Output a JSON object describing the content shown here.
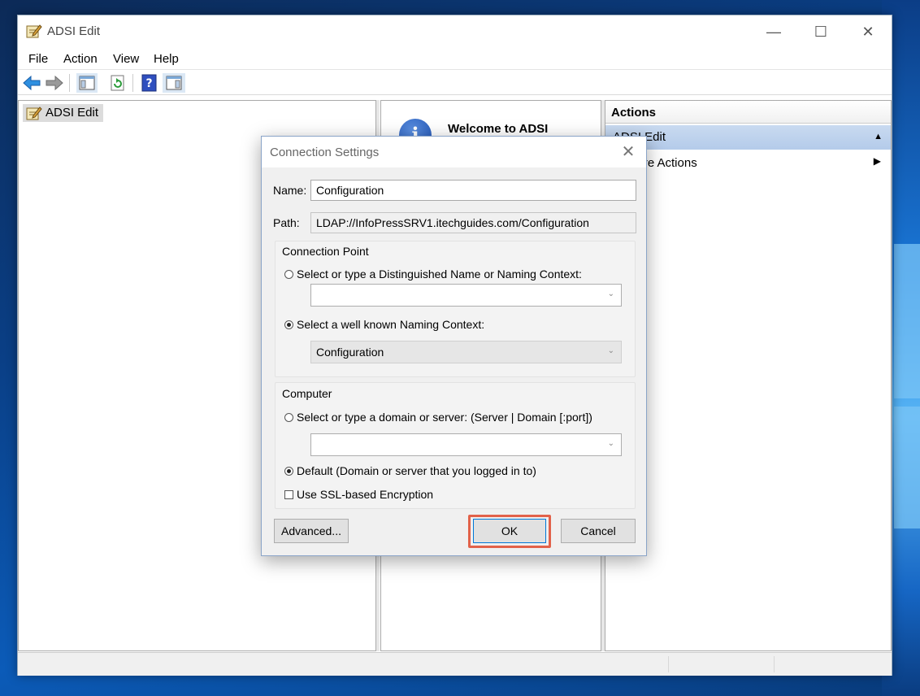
{
  "window": {
    "title": "ADSI Edit",
    "minimize_glyph": "—",
    "maximize_glyph": "☐",
    "close_glyph": "✕"
  },
  "menu": {
    "items": [
      "File",
      "Action",
      "View",
      "Help"
    ]
  },
  "toolbar": {
    "icons": [
      "back-arrow-icon",
      "forward-arrow-icon",
      "show-hide-console-tree-icon",
      "refresh-icon",
      "help-icon",
      "show-hide-action-pane-icon"
    ]
  },
  "tree": {
    "root_label": "ADSI Edit"
  },
  "center": {
    "welcome_title": "Welcome to ADSI",
    "info_glyph": "i"
  },
  "actions": {
    "header": "Actions",
    "section_label": "ADSI Edit",
    "section_arrow": "▲",
    "more_actions": "More Actions",
    "more_arrow": "▶"
  },
  "dialog": {
    "title": "Connection Settings",
    "close_glyph": "✕",
    "name_label": "Name:",
    "name_value": "Configuration",
    "path_label": "Path:",
    "path_value": "LDAP://InfoPressSRV1.itechguides.com/Configuration",
    "connection_point": {
      "title": "Connection Point",
      "option_dn": "Select or type a Distinguished Name or Naming Context:",
      "dn_value": "",
      "option_well_known": "Select a well known Naming Context:",
      "well_known_value": "Configuration",
      "selected": "well_known"
    },
    "computer": {
      "title": "Computer",
      "option_server": "Select or type a domain or server: (Server | Domain [:port])",
      "server_value": "",
      "option_default": "Default (Domain or server that you logged in to)",
      "selected": "default",
      "ssl_label": "Use SSL-based Encryption",
      "ssl_checked": false
    },
    "buttons": {
      "advanced": "Advanced...",
      "ok": "OK",
      "cancel": "Cancel"
    },
    "combo_caret": "⌄",
    "highlight_color": "#e2624a"
  }
}
